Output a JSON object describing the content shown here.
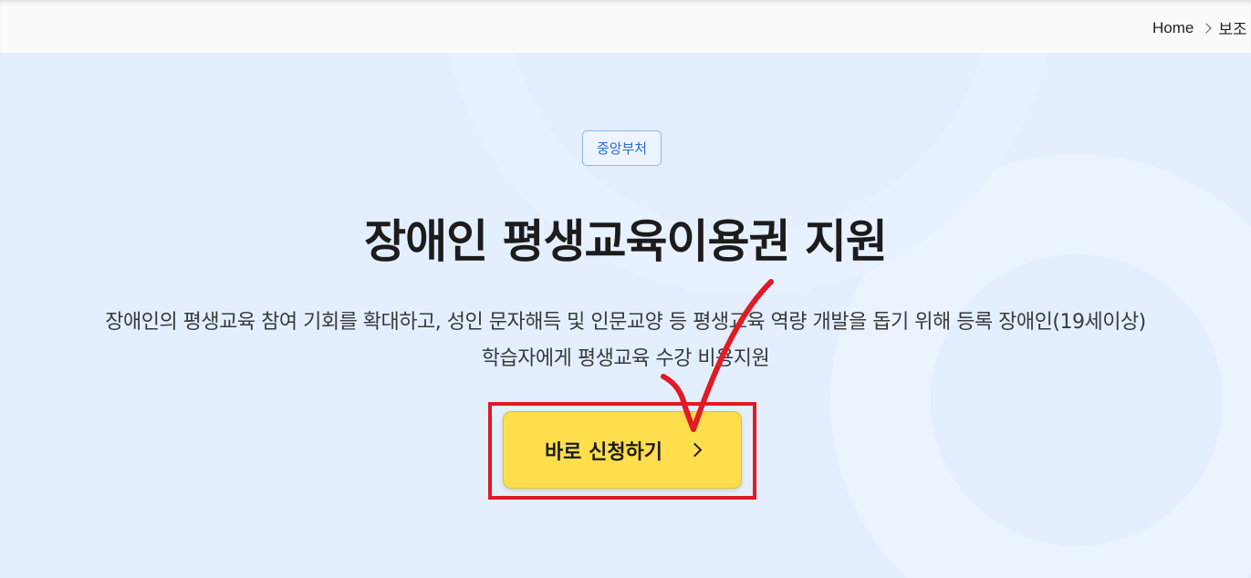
{
  "breadcrumb": {
    "home": "Home",
    "current": "보조"
  },
  "badge": "중앙부처",
  "title": "장애인 평생교육이용권 지원",
  "description": {
    "line1": "장애인의 평생교육 참여 기회를 확대하고, 성인 문자해득 및 인문교양 등 평생교육 역량 개발을 돕기 위해 등록 장애인(19세이상)",
    "line2": "학습자에게 평생교육 수강 비용지원"
  },
  "apply_button": {
    "label": "바로 신청하기",
    "icon": "chevron-right-icon"
  },
  "colors": {
    "hero_bg": "#e3efff",
    "badge_text": "#2d6ad0",
    "button_bg": "#ffde4d",
    "annotation_red": "#e01b24"
  }
}
